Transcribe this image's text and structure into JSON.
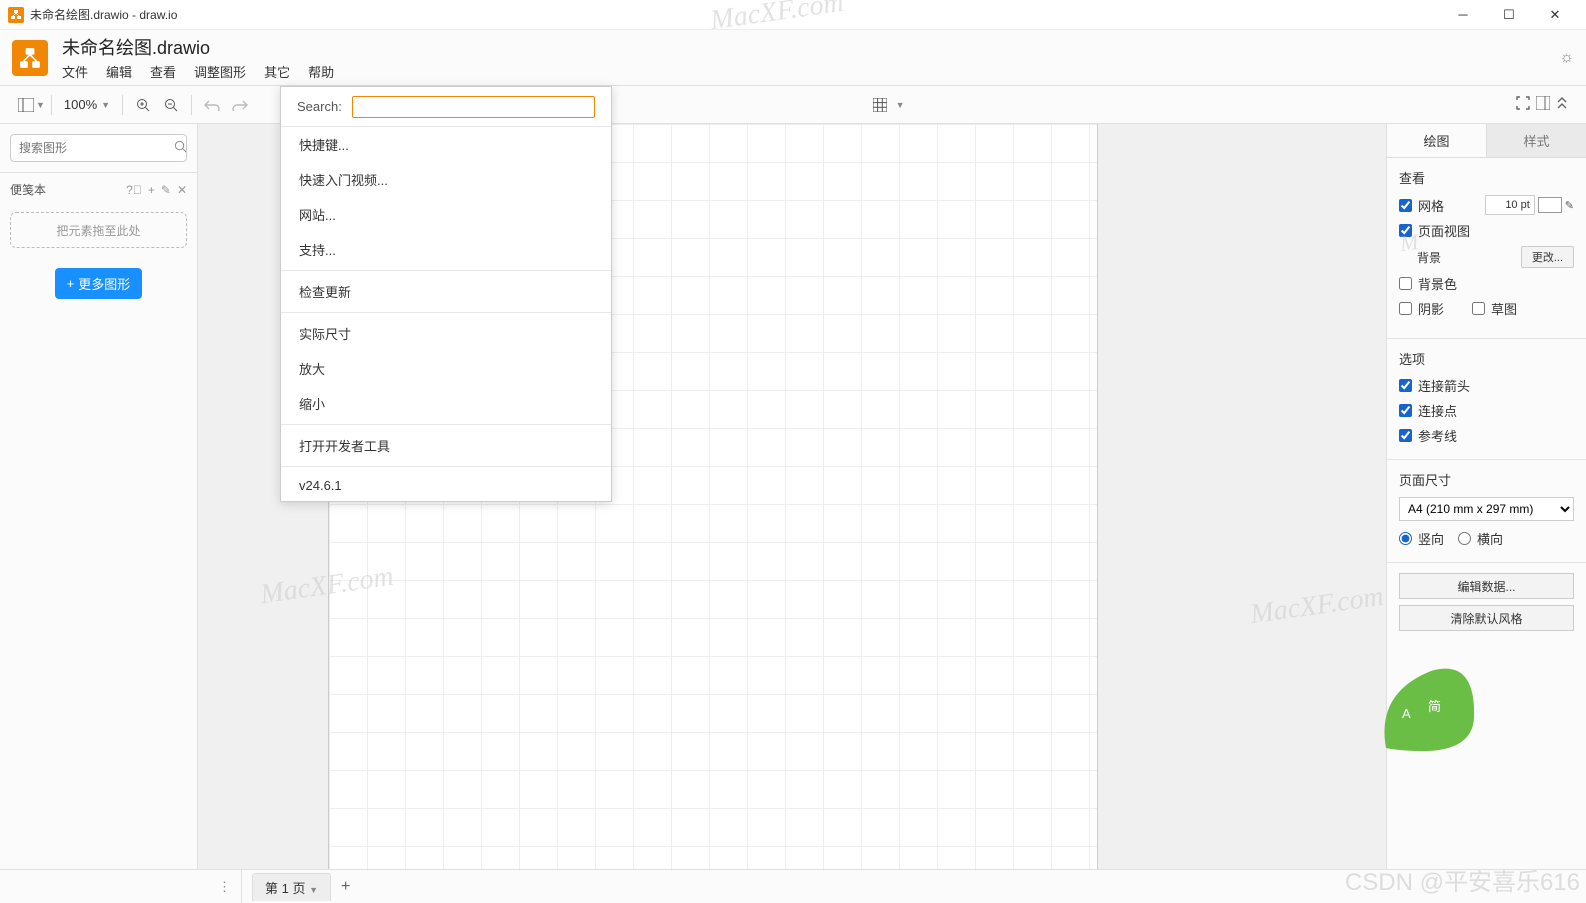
{
  "window": {
    "title": "未命名绘图.drawio - draw.io"
  },
  "header": {
    "doc_title": "未命名绘图.drawio",
    "menus": [
      "文件",
      "编辑",
      "查看",
      "调整图形",
      "其它",
      "帮助"
    ]
  },
  "toolbar": {
    "zoom": "100%"
  },
  "left": {
    "search_placeholder": "搜索图形",
    "scratchpad_label": "便笺本",
    "dropzone": "把元素拖至此处",
    "more_shapes": "更多图形"
  },
  "help_menu": {
    "search_label": "Search:",
    "items_1": [
      "快捷键...",
      "快速入门视频...",
      "网站...",
      "支持..."
    ],
    "items_2": [
      "检查更新"
    ],
    "items_3": [
      "实际尺寸",
      "放大",
      "缩小"
    ],
    "items_4": [
      "打开开发者工具"
    ],
    "version": "v24.6.1"
  },
  "right": {
    "tab_diagram": "绘图",
    "tab_style": "样式",
    "view_label": "查看",
    "grid": "网格",
    "grid_size": "10 pt",
    "page_view": "页面视图",
    "background": "背景",
    "change": "更改...",
    "bg_color": "背景色",
    "shadow": "阴影",
    "sketch": "草图",
    "options_label": "选项",
    "conn_arrows": "连接箭头",
    "conn_points": "连接点",
    "guides": "参考线",
    "page_size_label": "页面尺寸",
    "page_size_value": "A4 (210 mm x 297 mm)",
    "portrait": "竖向",
    "landscape": "横向",
    "edit_data": "编辑数据...",
    "clear_style": "清除默认风格"
  },
  "footer": {
    "page_tab": "第 1 页"
  },
  "watermark": {
    "text": "MacXF.com",
    "csdn": "CSDN @平安喜乐616",
    "leaf": "简"
  }
}
